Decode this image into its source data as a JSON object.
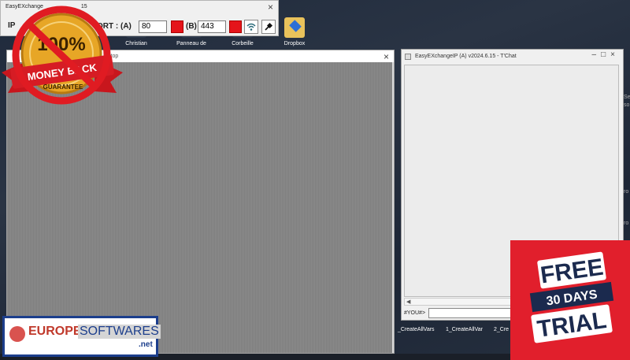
{
  "desktop_icons": [
    {
      "label": "Christian"
    },
    {
      "label": "Panneau de"
    },
    {
      "label": "Corbeille"
    },
    {
      "label": "Dropbox"
    }
  ],
  "toolbar_window": {
    "title": "EasyEXchange",
    "title_suffix": "15",
    "ip_label": "IP",
    "port_label": "ORT : (A)",
    "port_a_value": "80",
    "port_b_label": "(B)",
    "port_b_value": "443",
    "status_color": "#e5141a"
  },
  "main_window": {
    "title": "xtop"
  },
  "chat_window": {
    "title": "EasyEXchangeIP (A) v2024.6.15 - T'Chat",
    "prompt": "#YOU#>",
    "input_value": "",
    "window_controls": [
      "–",
      "□",
      "×"
    ]
  },
  "bottom_labels": [
    "_CreateAllVars",
    "1_CreateAllVar",
    "2_Cre"
  ],
  "right_slivers": [
    "Se",
    "so",
    "ro",
    "ro"
  ],
  "badge": {
    "line1": "100%",
    "line2": "MONEY BACK",
    "line3": "GUARANTEE",
    "ring_color": "#e01b22",
    "gold_color": "#e7a626"
  },
  "europe_logo": {
    "part1": "EUROPE",
    "part2": "SOFTWARES",
    "suffix": ".net",
    "accent": "#c0392b",
    "brand": "#1c3e8c"
  },
  "trial": {
    "line1": "FREE",
    "line2": "30 DAYS",
    "line3": "TRIAL",
    "bg": "#e11f2c",
    "navy": "#1b2a4e"
  }
}
